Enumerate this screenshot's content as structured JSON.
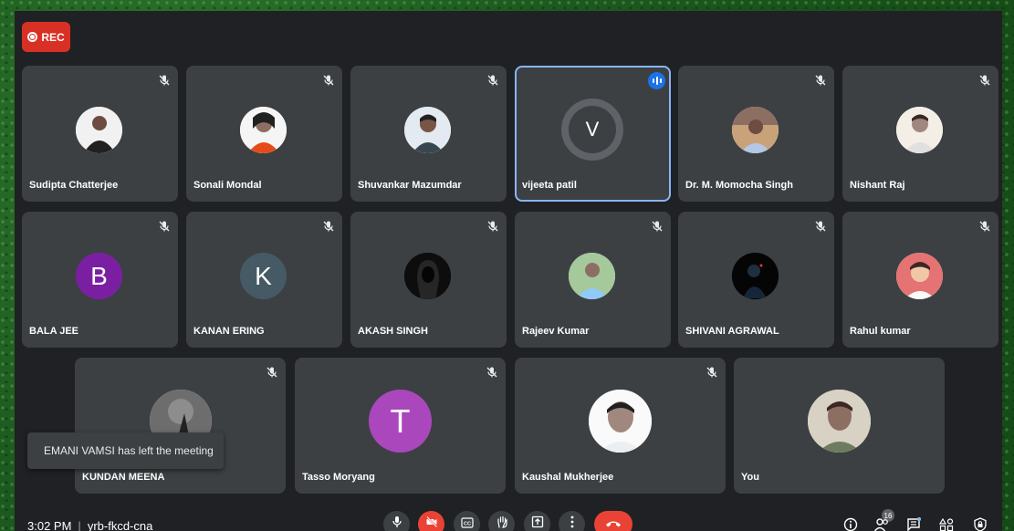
{
  "recording": {
    "label": "REC"
  },
  "participants": [
    {
      "name": "Sudipta Chatterjee",
      "avatar": "photo",
      "icon": "mic-off-icon"
    },
    {
      "name": "Sonali Mondal",
      "avatar": "photo",
      "icon": "mic-off-icon"
    },
    {
      "name": "Shuvankar Mazumdar",
      "avatar": "photo",
      "icon": "mic-off-icon"
    },
    {
      "name": "vijeeta patil",
      "avatar": "letter",
      "letter": "V",
      "avatar_color": "#5f6368",
      "icon": "speaking-icon",
      "active": true
    },
    {
      "name": "Dr. M. Momocha Singh",
      "avatar": "photo",
      "icon": "mic-off-icon"
    },
    {
      "name": "Nishant Raj",
      "avatar": "photo",
      "icon": "mic-off-icon"
    },
    {
      "name": "BALA JEE",
      "avatar": "letter",
      "letter": "B",
      "avatar_color": "#7b1fa2",
      "icon": "mic-off-icon"
    },
    {
      "name": "KANAN ERING",
      "avatar": "letter",
      "letter": "K",
      "avatar_color": "#455a64",
      "icon": "mic-off-icon"
    },
    {
      "name": "AKASH SINGH",
      "avatar": "photo",
      "icon": "mic-off-icon"
    },
    {
      "name": "Rajeev Kumar",
      "avatar": "photo",
      "icon": "mic-off-icon"
    },
    {
      "name": "SHIVANI AGRAWAL",
      "avatar": "photo",
      "icon": "mic-off-icon"
    },
    {
      "name": "Rahul kumar",
      "avatar": "photo",
      "icon": "mic-off-icon"
    },
    {
      "name": "KUNDAN MEENA",
      "avatar": "photo",
      "icon": "mic-off-icon"
    },
    {
      "name": "Tasso Moryang",
      "avatar": "letter",
      "letter": "T",
      "avatar_color": "#ab47bc",
      "icon": "mic-off-icon"
    },
    {
      "name": "Kaushal Mukherjee",
      "avatar": "photo",
      "icon": "mic-off-icon"
    },
    {
      "name": "You",
      "avatar": "photo",
      "icon": "none"
    }
  ],
  "notification": {
    "text": "EMANI VAMSI has left the meeting"
  },
  "bottom_bar": {
    "time": "3:02 PM",
    "separator": "|",
    "meeting_code": "yrb-fkcd-cna",
    "controls": [
      "microphone-icon",
      "camera-off-icon",
      "captions-icon",
      "raise-hand-icon",
      "present-screen-icon",
      "more-options-icon",
      "end-call-icon"
    ],
    "right_controls": [
      "info-icon",
      "people-icon",
      "chat-icon",
      "activities-icon",
      "host-controls-icon"
    ],
    "people_count": "16"
  },
  "colors": {
    "background": "#202124",
    "tile": "#3c4043",
    "rec": "#d93025",
    "end_call": "#ea4335",
    "active_border": "#8ab4f8",
    "speaking": "#1a73e8"
  }
}
